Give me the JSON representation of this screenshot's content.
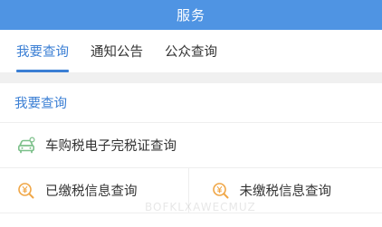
{
  "header": {
    "title": "服务"
  },
  "tabs": [
    {
      "label": "我要查询",
      "active": true
    },
    {
      "label": "通知公告",
      "active": false
    },
    {
      "label": "公众查询",
      "active": false
    }
  ],
  "section": {
    "title": "我要查询"
  },
  "items": {
    "car_tax": {
      "label": "车购税电子完税证查询",
      "icon": "car-icon"
    },
    "paid": {
      "label": "已缴税信息查询",
      "icon": "yuan-search-icon"
    },
    "unpaid": {
      "label": "未缴税信息查询",
      "icon": "yuan-search-icon"
    }
  },
  "watermark": "BOFKLXAWECMUZ",
  "colors": {
    "header_bg": "#4f94e3",
    "accent": "#3b7fd4",
    "icon_green": "#7cc08a",
    "icon_orange": "#f0a646"
  }
}
